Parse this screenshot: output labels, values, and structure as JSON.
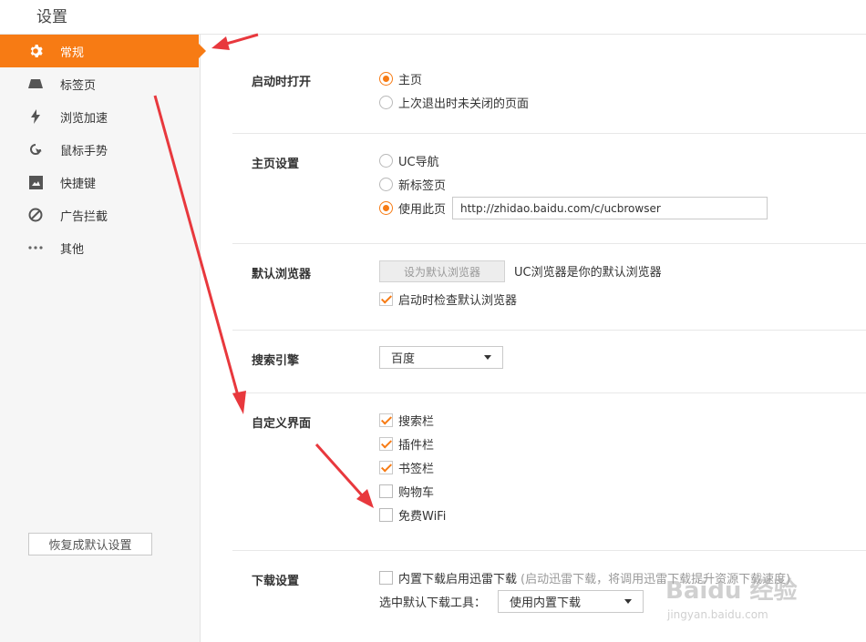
{
  "window": {
    "title": "设置"
  },
  "sidebar": {
    "items": [
      {
        "label": "常规",
        "icon": "gear-icon",
        "active": true
      },
      {
        "label": "标签页",
        "icon": "tab-icon"
      },
      {
        "label": "浏览加速",
        "icon": "lightning-icon"
      },
      {
        "label": "鼠标手势",
        "icon": "mouse-gesture-icon"
      },
      {
        "label": "快捷键",
        "icon": "shortcut-icon"
      },
      {
        "label": "广告拦截",
        "icon": "block-icon"
      },
      {
        "label": "其他",
        "icon": "more-icon"
      }
    ],
    "reset_label": "恢复成默认设置"
  },
  "startup": {
    "label": "启动时打开",
    "options": [
      "主页",
      "上次退出时未关闭的页面"
    ],
    "selected": 0
  },
  "homepage": {
    "label": "主页设置",
    "options": [
      "UC导航",
      "新标签页",
      "使用此页"
    ],
    "selected": 2,
    "url": "http://zhidao.baidu.com/c/ucbrowser"
  },
  "default_browser": {
    "label": "默认浏览器",
    "button_label": "设为默认浏览器",
    "status": "UC浏览器是你的默认浏览器",
    "check_label": "启动时检查默认浏览器",
    "checked": true
  },
  "search": {
    "label": "搜索引擎",
    "value": "百度"
  },
  "custom_ui": {
    "label": "自定义界面",
    "items": [
      {
        "label": "搜索栏",
        "checked": true
      },
      {
        "label": "插件栏",
        "checked": true
      },
      {
        "label": "书签栏",
        "checked": true
      },
      {
        "label": "购物车",
        "checked": false
      },
      {
        "label": "免费WiFi",
        "checked": false
      }
    ]
  },
  "download": {
    "label": "下载设置",
    "check_label": "内置下载启用迅雷下载",
    "hint": "(启动迅雷下载，将调用迅雷下载提升资源下载速度)",
    "tool_label": "选中默认下载工具：",
    "tool_value": "使用内置下载"
  },
  "watermark": {
    "text": "Baidu 经验",
    "sub": "jingyan.baidu.com"
  },
  "colors": {
    "accent": "#f77b14",
    "arrow": "#e8383d"
  }
}
